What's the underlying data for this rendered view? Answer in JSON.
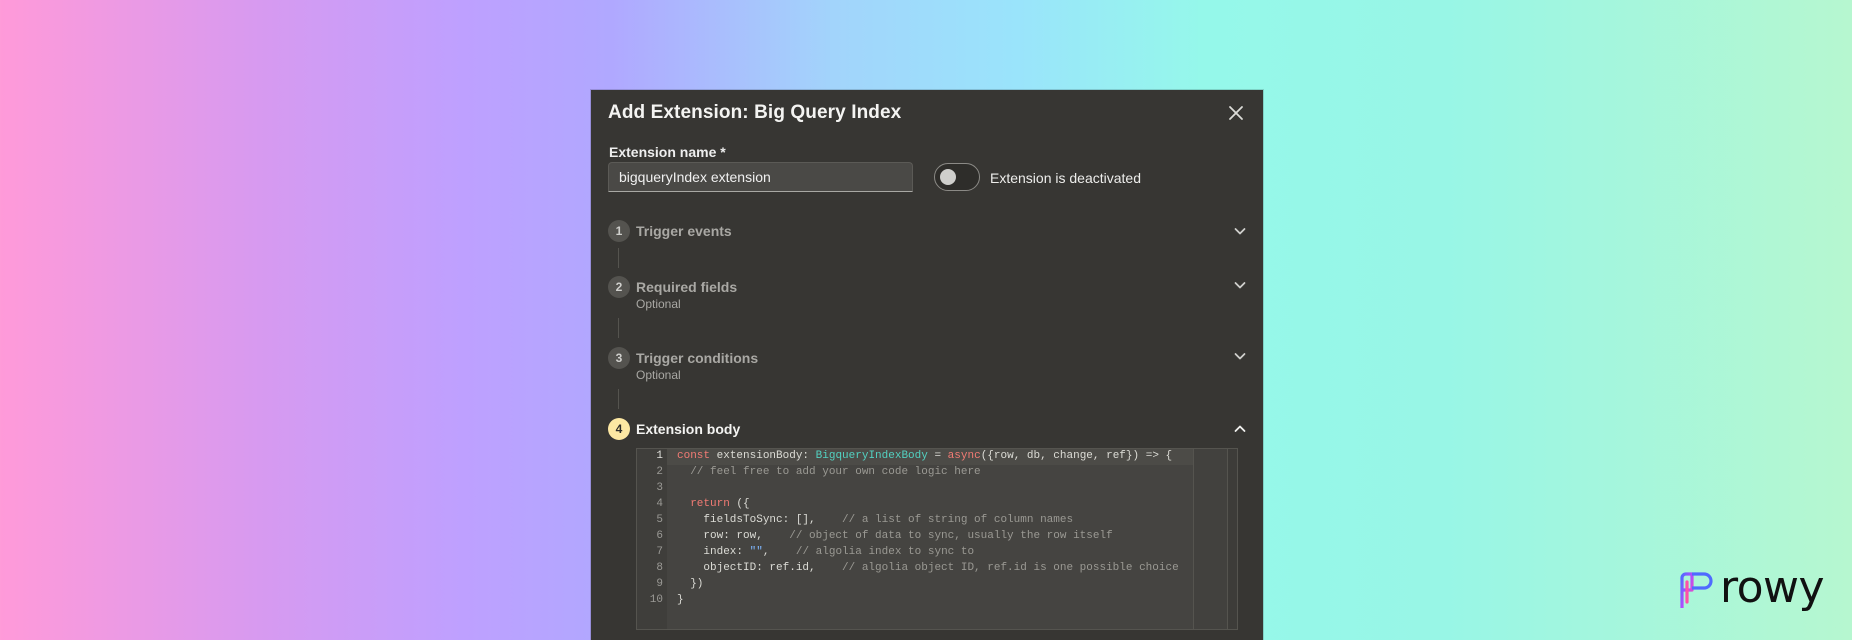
{
  "dialog": {
    "title": "Add Extension: Big Query Index",
    "name_label": "Extension name *",
    "name_value": "bigqueryIndex extension",
    "toggle_label": "Extension is deactivated",
    "toggle_on": false
  },
  "steps": [
    {
      "num": "1",
      "title": "Trigger events",
      "subtitle": "",
      "expanded": false
    },
    {
      "num": "2",
      "title": "Required fields",
      "subtitle": "Optional",
      "expanded": false
    },
    {
      "num": "3",
      "title": "Trigger conditions",
      "subtitle": "Optional",
      "expanded": false
    },
    {
      "num": "4",
      "title": "Extension body",
      "subtitle": "",
      "expanded": true
    }
  ],
  "editor": {
    "line_numbers": [
      "1",
      "2",
      "3",
      "4",
      "5",
      "6",
      "7",
      "8",
      "9",
      "10"
    ],
    "current_line": 1
  },
  "brand": {
    "logo_text": "rowy"
  },
  "colors": {
    "active_step": "#fde8a3",
    "dialog_bg": "#373633",
    "keyword": "#f27b74",
    "type": "#53d1c1"
  },
  "icons": {
    "close": "close-icon",
    "collapsed": "chevron-down-icon",
    "expanded": "chevron-up-icon"
  }
}
